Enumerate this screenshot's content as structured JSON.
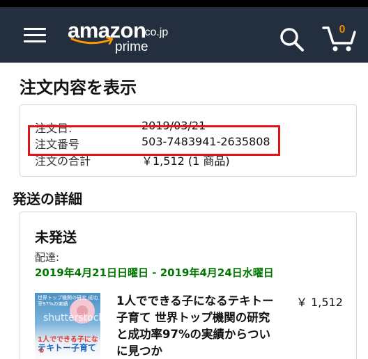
{
  "header": {
    "logo_text": "amazon",
    "logo_domain": ".co.jp",
    "logo_sub": "prime",
    "cart_count": "0",
    "icons": [
      "hamburger-menu-icon",
      "search-icon",
      "cart-icon"
    ],
    "colors": {
      "nav_bg": "#232f3e",
      "smile": "#ff9900",
      "cart_count": "#f08804"
    }
  },
  "page": {
    "title": "注文内容を表示"
  },
  "order_summary": {
    "rows": [
      {
        "label": "注文日:",
        "value": "2019/03/21"
      },
      {
        "label": "注文番号",
        "value": "503-7483941-2635808"
      },
      {
        "label": "注文の合計",
        "value": "￥1,512 (1 商品)"
      }
    ],
    "highlight_color": "#e0121a"
  },
  "shipment": {
    "heading": "発送の詳細",
    "status": "未発送",
    "delivery_label": "配達:",
    "delivery_range": "2019年4月21日日曜日 - 2019年4月24日水曜日",
    "delivery_color": "#007600",
    "item": {
      "title": "1人でできる子になるテキトー子育て 世界トップ機関の研究と成功率97%の実績からついに見つか",
      "price": "￥ 1,512",
      "thumbnail": {
        "top_text": "世界トップ機関の研究 成功率97%の実績",
        "watermark": "shutterstock",
        "subtitle": "1人でできる子になる",
        "main_title": "テキトー子育て"
      }
    }
  }
}
